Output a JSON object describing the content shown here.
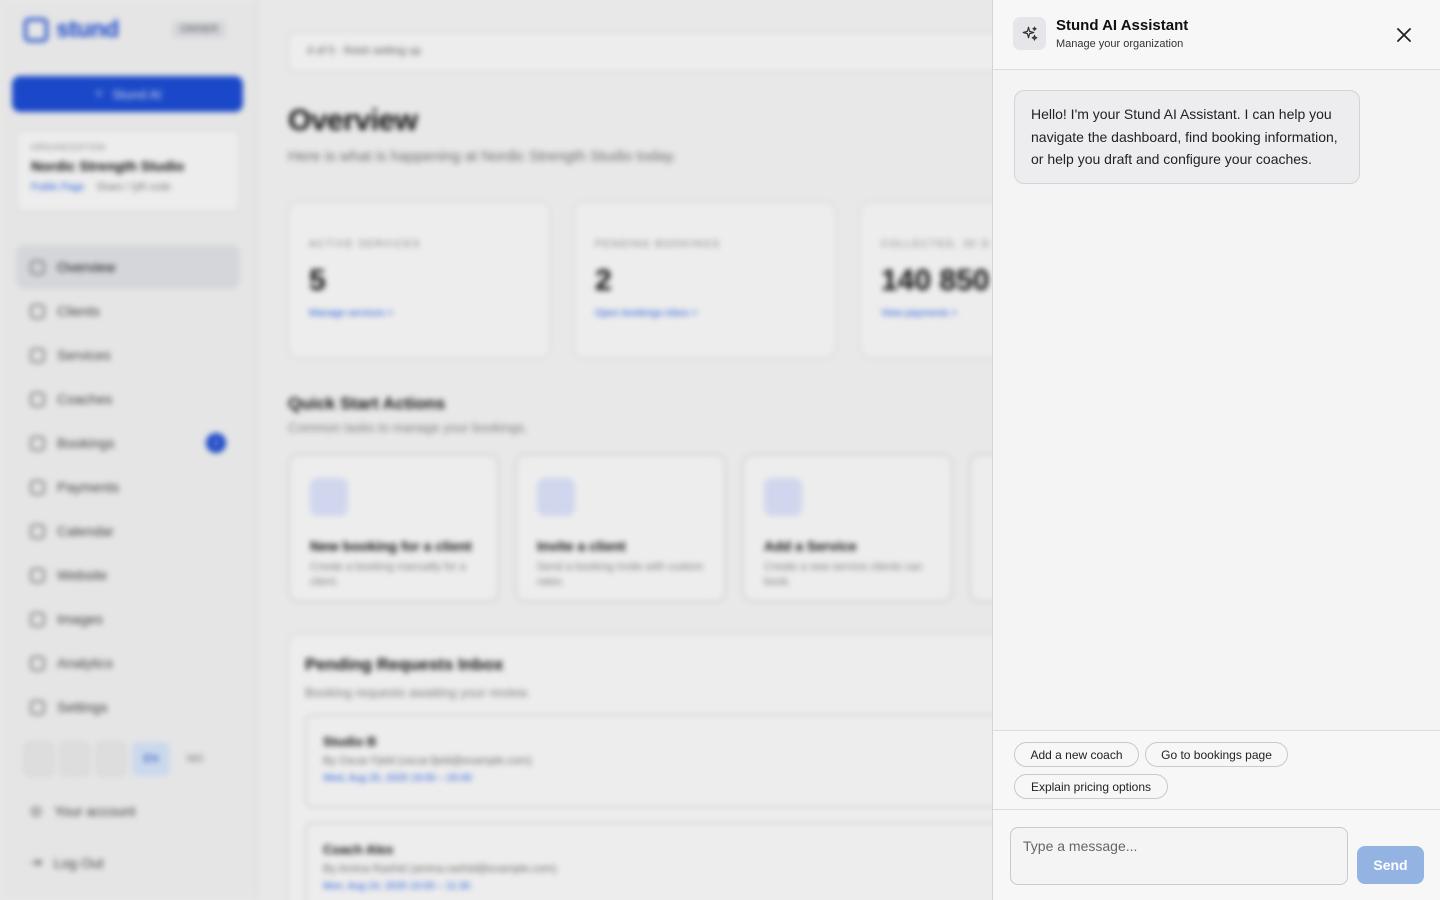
{
  "app": {
    "brand": "stund",
    "role_badge": "OWNER",
    "ai_button": "Stund AI",
    "org": {
      "caption": "ORGANIZATION",
      "name": "Nordic Strength Studio",
      "public_link": "Public Page",
      "share_link": "Share / QR code"
    },
    "nav": [
      {
        "label": "Overview",
        "icon": "grid-icon",
        "active": true
      },
      {
        "label": "Clients",
        "icon": "id-card-icon"
      },
      {
        "label": "Services",
        "icon": "list-icon"
      },
      {
        "label": "Coaches",
        "icon": "link-icon"
      },
      {
        "label": "Bookings",
        "icon": "clipboard-icon",
        "badge": "2"
      },
      {
        "label": "Payments",
        "icon": "wallet-icon"
      },
      {
        "label": "Calendar",
        "icon": "calendar-icon"
      },
      {
        "label": "Website",
        "icon": "link-icon"
      },
      {
        "label": "Images",
        "icon": "image-icon"
      },
      {
        "label": "Analytics",
        "icon": "chart-icon"
      },
      {
        "label": "Settings",
        "icon": "gear-icon"
      }
    ],
    "languages": [
      "EN",
      "NO"
    ],
    "account_label": "Your account",
    "logout_label": "Log Out"
  },
  "main": {
    "setup_progress": "4 of 5 · finish setting up",
    "title": "Overview",
    "subtitle": "Here is what is happening at Nordic Strength Studio today.",
    "stats": [
      {
        "label": "ACTIVE SERVICES",
        "value": "5",
        "link": "Manage services >"
      },
      {
        "label": "PENDING BOOKINGS",
        "value": "2",
        "link": "Open bookings inbox >"
      },
      {
        "label": "COLLECTED, 30 D",
        "value": "140 850",
        "link": "View payments >"
      }
    ],
    "quick_start": {
      "title": "Quick Start Actions",
      "subtitle": "Common tasks to manage your bookings.",
      "cards": [
        {
          "title": "New booking for a client",
          "desc": "Create a booking manually for a client."
        },
        {
          "title": "Invite a client",
          "desc": "Send a booking invite with custom rates."
        },
        {
          "title": "Add a Service",
          "desc": "Create a new service clients can book."
        }
      ]
    },
    "inbox": {
      "title": "Pending Requests Inbox",
      "subtitle": "Booking requests awaiting your review.",
      "requests": [
        {
          "title": "Studio B",
          "by": "By Oscar Fjeld (oscar.fjeld@example.com)",
          "when": "Wed, Aug 25, 2025 19:00 – 20:00"
        },
        {
          "title": "Coach Alex",
          "by": "By Amina Rashid (amina.rashid@example.com)",
          "when": "Mon, Aug 24, 2025 10:00 – 11:30"
        }
      ]
    }
  },
  "assistant": {
    "title": "Stund AI Assistant",
    "subtitle": "Manage your organization",
    "greeting": "Hello! I'm your Stund AI Assistant. I can help you navigate the dashboard, find booking information, or help you draft and configure your coaches.",
    "suggestions": [
      "Add a new coach",
      "Go to bookings page",
      "Explain pricing options"
    ],
    "input_placeholder": "Type a message...",
    "send_label": "Send"
  }
}
